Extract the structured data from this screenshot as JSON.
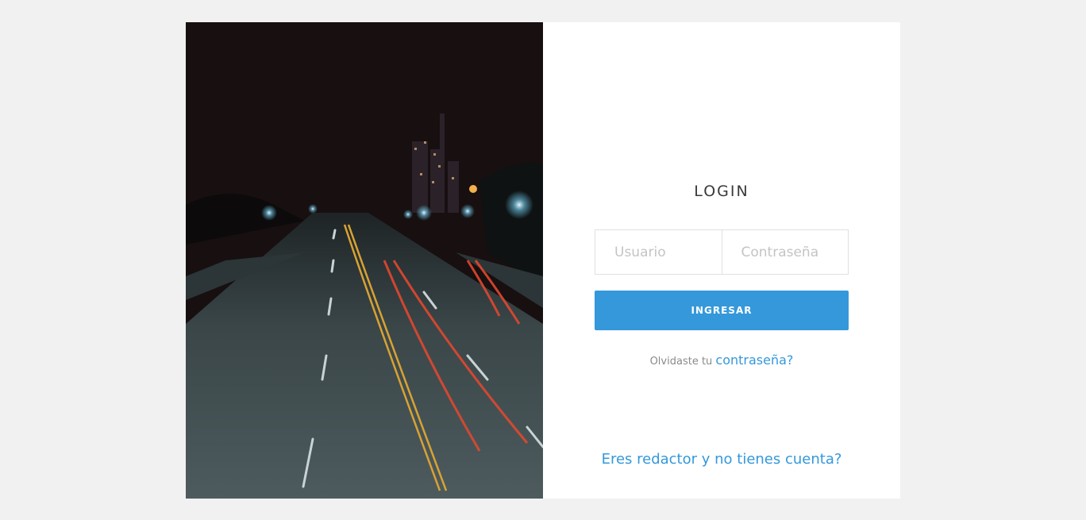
{
  "login": {
    "title": "LOGIN",
    "username_placeholder": "Usuario",
    "password_placeholder": "Contraseña",
    "submit_label": "INGRESAR",
    "forgot_prefix": "Olvidaste tu",
    "forgot_link": "contraseña?",
    "register_link": "Eres redactor y no tienes cuenta?"
  },
  "colors": {
    "accent": "#3498db",
    "page_background": "#f1f1f1",
    "photo_background": "#170f10"
  },
  "image": {
    "subject": "night-road-light-trails"
  }
}
